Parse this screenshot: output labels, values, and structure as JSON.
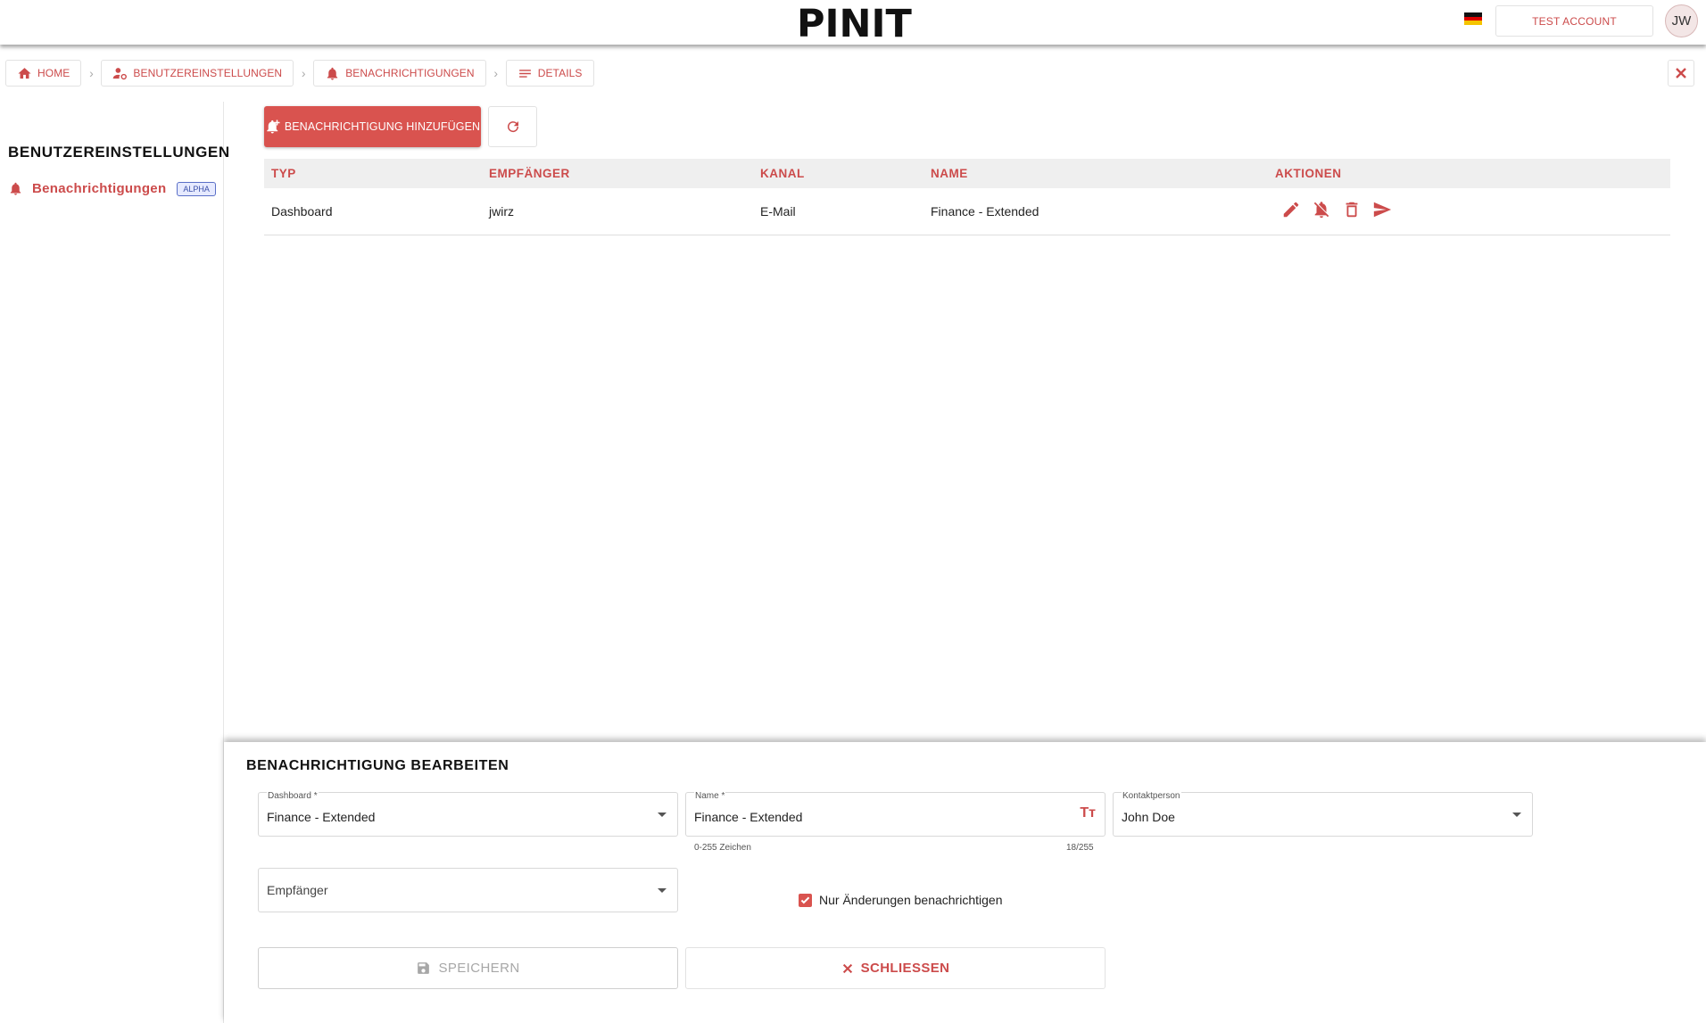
{
  "topbar": {
    "logo_text": "PINIT",
    "account_label": "TEST ACCOUNT",
    "avatar_initials": "JW",
    "language_flag": "de-flag-icon"
  },
  "breadcrumb": [
    {
      "label": "HOME",
      "icon": "home-icon"
    },
    {
      "label": "BENUTZEREINSTELLUNGEN",
      "icon": "user-settings-icon"
    },
    {
      "label": "BENACHRICHTIGUNGEN",
      "icon": "bell-icon"
    },
    {
      "label": "DETAILS",
      "icon": "list-icon"
    }
  ],
  "sidebar": {
    "title": "BENUTZEREINSTELLUNGEN",
    "items": [
      {
        "label": "Benachrichtigungen",
        "badge": "ALPHA",
        "icon": "bell-icon"
      }
    ]
  },
  "toolbar": {
    "add_label": "BENACHRICHTIGUNG HINZUFÜGEN"
  },
  "table": {
    "columns": [
      "TYP",
      "EMPFÄNGER",
      "KANAL",
      "NAME",
      "AKTIONEN"
    ],
    "rows": [
      {
        "typ": "Dashboard",
        "empfaenger": "jwirz",
        "kanal": "E-Mail",
        "name": "Finance - Extended"
      }
    ],
    "row_actions": [
      "edit-icon",
      "bell-off-icon",
      "delete-icon",
      "send-icon"
    ]
  },
  "edit_panel": {
    "title": "BENACHRICHTIGUNG BEARBEITEN",
    "dashboard": {
      "label": "Dashboard *",
      "value": "Finance - Extended"
    },
    "name": {
      "label": "Name *",
      "value": "Finance - Extended",
      "hint": "0-255 Zeichen",
      "counter": "18/255"
    },
    "kontaktperson": {
      "label": "Kontaktperson",
      "value": "John Doe"
    },
    "empfaenger": {
      "placeholder": "Empfänger"
    },
    "only_changes": {
      "label": "Nur Änderungen benachrichtigen",
      "checked": true
    },
    "save_label": "SPEICHERN",
    "close_label": "SCHLIESSEN"
  },
  "colors": {
    "accent": "#cc4b4b",
    "button_red": "#d9534f"
  }
}
